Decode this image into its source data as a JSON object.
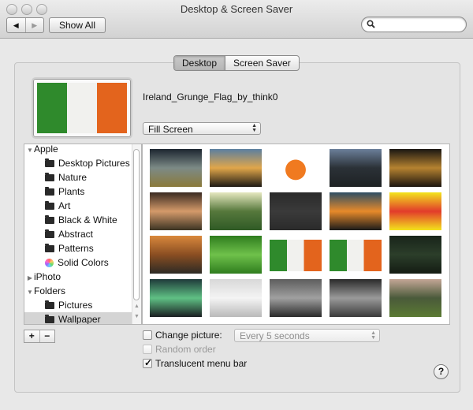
{
  "window": {
    "title": "Desktop & Screen Saver",
    "show_all_label": "Show All",
    "search_placeholder": ""
  },
  "tabs": [
    {
      "label": "Desktop",
      "active": true
    },
    {
      "label": "Screen Saver",
      "active": false
    }
  ],
  "current_picture": {
    "name": "Ireland_Grunge_Flag_by_think0",
    "fit_mode": "Fill Screen",
    "colors": [
      "#2f8a2c",
      "#f1f1ee",
      "#e3641d"
    ]
  },
  "sources": [
    {
      "label": "Apple",
      "type": "group",
      "expanded": true
    },
    {
      "label": "Desktop Pictures",
      "type": "folder"
    },
    {
      "label": "Nature",
      "type": "folder"
    },
    {
      "label": "Plants",
      "type": "folder"
    },
    {
      "label": "Art",
      "type": "folder"
    },
    {
      "label": "Black & White",
      "type": "folder"
    },
    {
      "label": "Abstract",
      "type": "folder"
    },
    {
      "label": "Patterns",
      "type": "folder"
    },
    {
      "label": "Solid Colors",
      "type": "colors"
    },
    {
      "label": "iPhoto",
      "type": "group",
      "expanded": false
    },
    {
      "label": "Folders",
      "type": "group",
      "expanded": true
    },
    {
      "label": "Pictures",
      "type": "folder"
    },
    {
      "label": "Wallpaper",
      "type": "folder",
      "selected": true
    }
  ],
  "thumbnails": [
    {
      "desc": "stormy field",
      "colors": [
        "#1c2530",
        "#7c8a86",
        "#8b7a3a"
      ]
    },
    {
      "desc": "tree silhouette sunset",
      "colors": [
        "#5b7fa0",
        "#e0a64a",
        "#1e1a14"
      ]
    },
    {
      "desc": "orange grunge tree",
      "colors": [
        "#ffffff",
        "#f07a20",
        "#ffffff"
      ]
    },
    {
      "desc": "dusk castle",
      "colors": [
        "#6b7f9a",
        "#2b3137",
        "#1e2224"
      ]
    },
    {
      "desc": "golden city lights",
      "colors": [
        "#1a1612",
        "#b58230",
        "#1c150f"
      ]
    },
    {
      "desc": "tractor sunset",
      "colors": [
        "#3a2a22",
        "#d49a6a",
        "#3b3322"
      ]
    },
    {
      "desc": "green hill",
      "colors": [
        "#e6e8c0",
        "#56783c",
        "#2f5a25"
      ]
    },
    {
      "desc": "dark dragonfly",
      "colors": [
        "#2a2a2a",
        "#3a3a3a",
        "#2a2a2a"
      ]
    },
    {
      "desc": "split day night",
      "colors": [
        "#2e4e63",
        "#e78a2a",
        "#1a1a1a"
      ]
    },
    {
      "desc": "yellow smileys",
      "colors": [
        "#f3e41c",
        "#e23b2b",
        "#f3e41c"
      ]
    },
    {
      "desc": "orange lake",
      "colors": [
        "#d9883c",
        "#8a4e22",
        "#2c2a24"
      ]
    },
    {
      "desc": "boxee logo",
      "colors": [
        "#2f7d1e",
        "#6fc14b",
        "#2f7d1e"
      ]
    },
    {
      "desc": "ireland flag",
      "colors": [
        "#2f8a2c",
        "#f1f1ee",
        "#e3641d"
      ]
    },
    {
      "desc": "ireland flag",
      "colors": [
        "#2f8a2c",
        "#f1f1ee",
        "#e3641d"
      ]
    },
    {
      "desc": "dark forest",
      "colors": [
        "#18241a",
        "#2c3e2a",
        "#141c13"
      ]
    },
    {
      "desc": "aurora",
      "colors": [
        "#1f3a3a",
        "#5fc084",
        "#1a1e22"
      ]
    },
    {
      "desc": "snowy trees",
      "colors": [
        "#d8d8d8",
        "#f4f4f4",
        "#b9b9b9"
      ]
    },
    {
      "desc": "bw field",
      "colors": [
        "#5d5d5d",
        "#a0a0a0",
        "#2a2a2a"
      ]
    },
    {
      "desc": "bw landscape",
      "colors": [
        "#2a2a2a",
        "#9a9a9a",
        "#3a3a3a"
      ]
    },
    {
      "desc": "mountain cabin",
      "colors": [
        "#c4a696",
        "#4a5a3a",
        "#5b7a33"
      ]
    }
  ],
  "controls": {
    "plus_label": "+",
    "minus_label": "−",
    "change_picture_label": "Change picture:",
    "change_picture_checked": false,
    "interval_value": "Every 5 seconds",
    "random_order_label": "Random order",
    "random_order_checked": false,
    "translucent_label": "Translucent menu bar",
    "translucent_checked": true,
    "help_label": "?"
  }
}
